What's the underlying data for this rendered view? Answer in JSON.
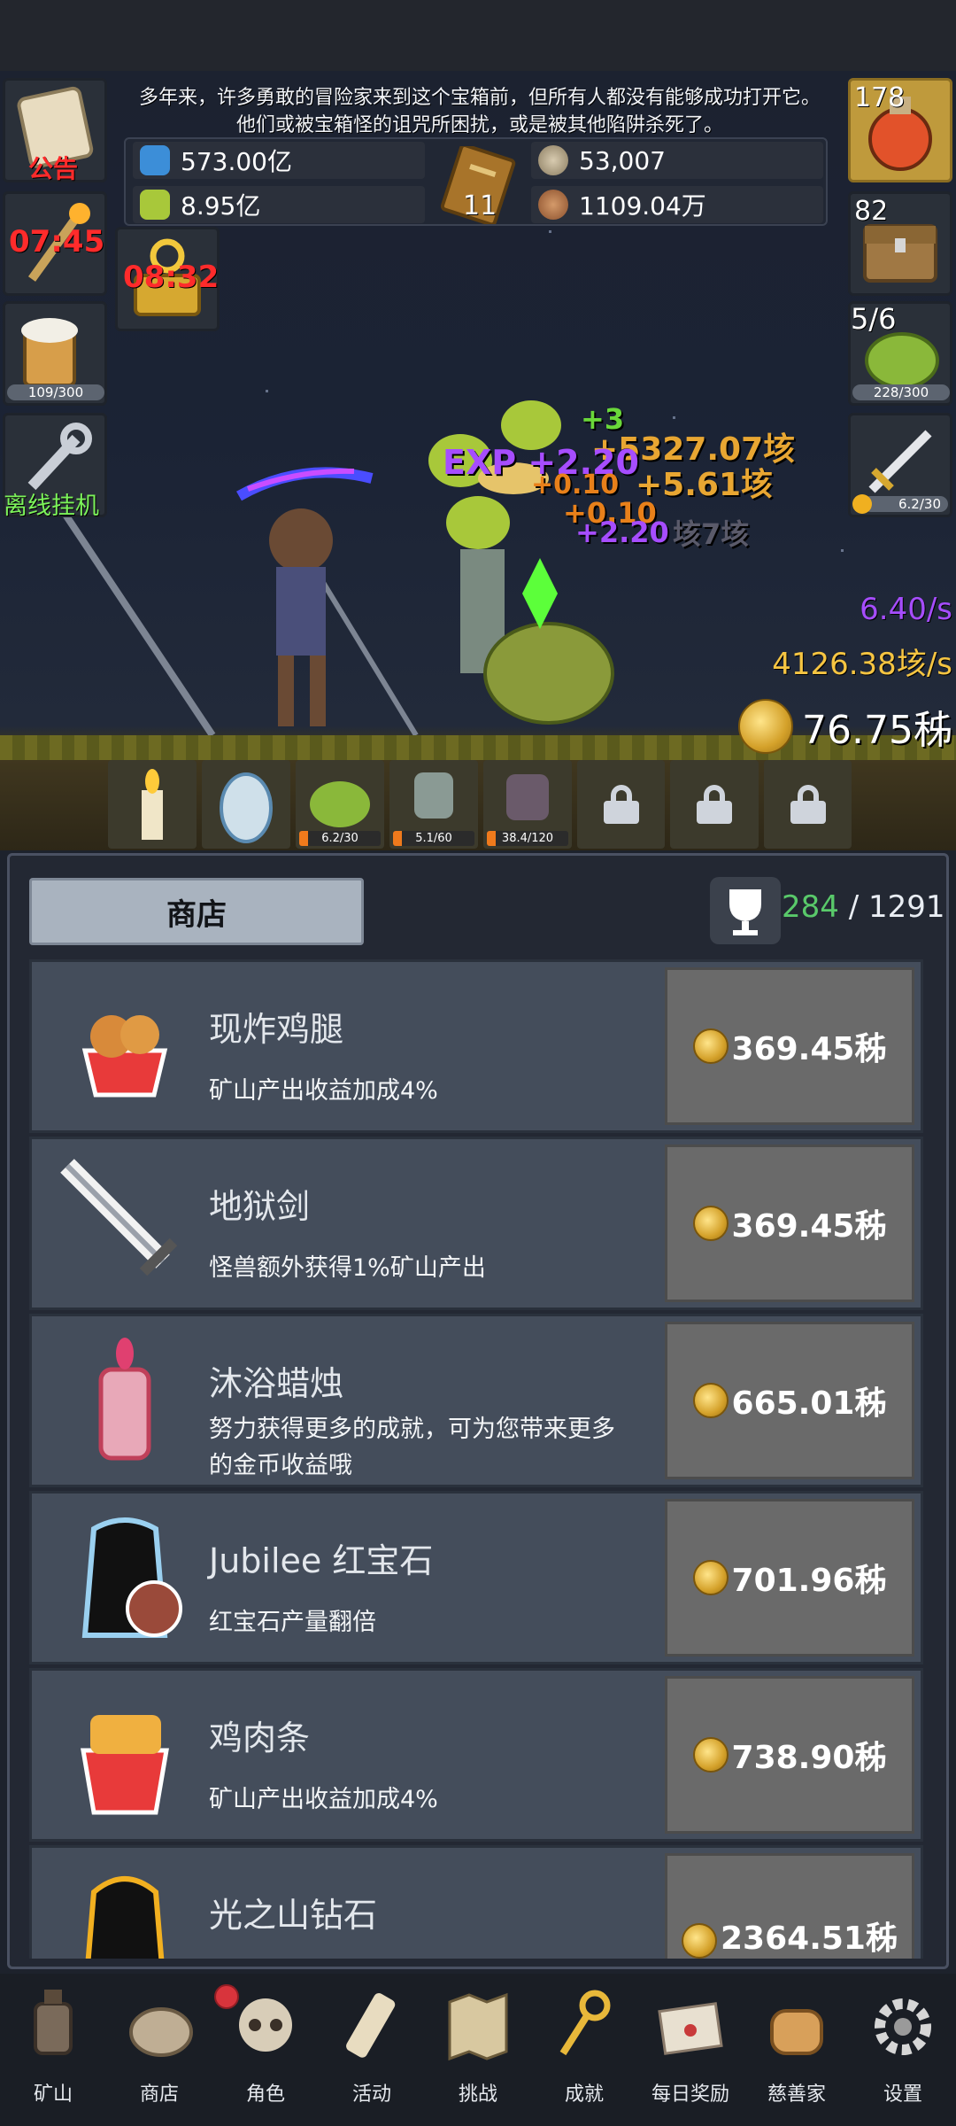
{
  "story_text": {
    "line1": "多年来，许多勇敢的冒险家来到这个宝箱前，但所有人都没有能够成功打开它。",
    "line2": "他们或被宝箱怪的诅咒所困扰，或是被其他陷阱杀死了。"
  },
  "resources": {
    "blue_potion": "573.00亿",
    "green_potion": "8.95亿",
    "book_count": "11",
    "coin_total": "53,007",
    "meat": "1109.04万"
  },
  "left_column": {
    "announcement_label": "公告",
    "torch_timer": "07:45",
    "key_timer": "08:32",
    "beer_progress": "109/300",
    "offline_label": "离线挂机"
  },
  "right_column": {
    "potion_count": "178",
    "chest_count": "82",
    "slime_ratio": "5/6",
    "slime_progress": "228/300",
    "sword_progress": "6.2/30"
  },
  "rates": {
    "exp_rate": "6.40/s",
    "gold_rate": "4126.38垓/s",
    "gold_total": "76.75秭"
  },
  "floating_text": {
    "t1": "+5327.07垓",
    "t2": "EXP +2.20",
    "t3": "+3",
    "t4": "+5.61垓",
    "t5": "+0.10",
    "t6": "+2.20",
    "t7": "+0.10",
    "t8": "垓7垓"
  },
  "monster_bar": [
    {
      "name": "candle"
    },
    {
      "name": "egg"
    },
    {
      "name": "slime",
      "progress": "6.2/30"
    },
    {
      "name": "zombie",
      "progress": "5.1/60"
    },
    {
      "name": "demon",
      "progress": "38.4/120"
    },
    {
      "name": "locked"
    },
    {
      "name": "locked"
    },
    {
      "name": "locked"
    }
  ],
  "shop": {
    "tab_label": "商店",
    "trophy_current": "284",
    "trophy_sep": " / ",
    "trophy_total": "1291",
    "items": [
      {
        "name": "现炸鸡腿",
        "desc": "矿山产出收益加成4%",
        "price": "369.45秭"
      },
      {
        "name": "地狱剑",
        "desc": "怪兽额外获得1%矿山产出",
        "price": "369.45秭"
      },
      {
        "name": "沐浴蜡烛",
        "desc": "努力获得更多的成就，可为您带来更多的金币收益哦",
        "price": "665.01秭"
      },
      {
        "name": "Jubilee 红宝石",
        "desc": "红宝石产量翻倍",
        "price": "701.96秭"
      },
      {
        "name": "鸡肉条",
        "desc": "矿山产出收益加成4%",
        "price": "738.90秭"
      },
      {
        "name": "光之山钻石",
        "desc": "",
        "price": "2364.51秭"
      }
    ]
  },
  "nav": [
    {
      "label": "矿山",
      "icon": "lantern-icon"
    },
    {
      "label": "商店",
      "icon": "bag-icon"
    },
    {
      "label": "角色",
      "icon": "skull-icon"
    },
    {
      "label": "活动",
      "icon": "scroll-icon"
    },
    {
      "label": "挑战",
      "icon": "map-icon"
    },
    {
      "label": "成就",
      "icon": "key-icon"
    },
    {
      "label": "每日奖励",
      "icon": "envelope-icon"
    },
    {
      "label": "慈善家",
      "icon": "bread-icon"
    },
    {
      "label": "设置",
      "icon": "gear-icon"
    }
  ],
  "colors": {
    "accent_gold": "#f6c542",
    "exp_purple": "#a64dff",
    "trophy_green": "#59c96a",
    "timer_red": "#ff2b2b"
  }
}
